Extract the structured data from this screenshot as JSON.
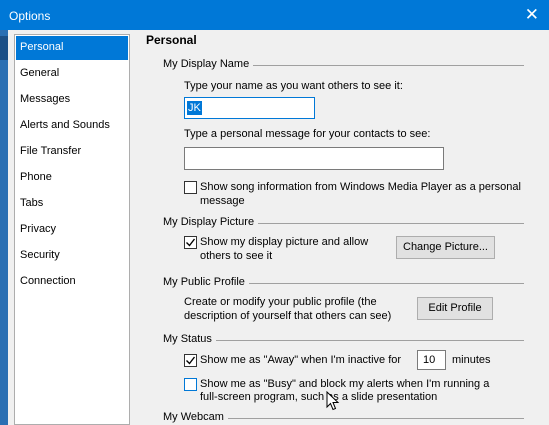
{
  "window": {
    "title": "Options",
    "close_glyph": "✕"
  },
  "sidebar": {
    "items": [
      {
        "label": "Personal",
        "selected": true
      },
      {
        "label": "General",
        "selected": false
      },
      {
        "label": "Messages",
        "selected": false
      },
      {
        "label": "Alerts and Sounds",
        "selected": false
      },
      {
        "label": "File Transfer",
        "selected": false
      },
      {
        "label": "Phone",
        "selected": false
      },
      {
        "label": "Tabs",
        "selected": false
      },
      {
        "label": "Privacy",
        "selected": false
      },
      {
        "label": "Security",
        "selected": false
      },
      {
        "label": "Connection",
        "selected": false
      }
    ]
  },
  "page": {
    "heading": "Personal",
    "display_name": {
      "group_label": "My Display Name",
      "name_prompt": "Type your name as you want others to see it:",
      "name_value": "JK",
      "message_prompt": "Type a personal message for your contacts to see:",
      "message_value": "",
      "song_checkbox_line1": "Show song information from Windows Media Player as a personal",
      "song_checkbox_line2": "message",
      "song_checked": false
    },
    "display_picture": {
      "group_label": "My Display Picture",
      "show_line1": "Show my display picture and allow",
      "show_line2": "others to see it",
      "show_checked": true,
      "change_button": "Change Picture..."
    },
    "public_profile": {
      "group_label": "My Public Profile",
      "desc_line1": "Create or modify your public profile (the",
      "desc_line2": "description of yourself that others can see)",
      "edit_button": "Edit Profile"
    },
    "status": {
      "group_label": "My Status",
      "away_label": "Show me as \"Away\" when I'm inactive for",
      "away_checked": true,
      "away_minutes": "10",
      "minutes_label": "minutes",
      "busy_line1": "Show me as \"Busy\" and block my alerts when I'm running a",
      "busy_line2": "full-screen program, such as a slide presentation",
      "busy_checked": false
    },
    "webcam": {
      "group_label": "My Webcam"
    }
  },
  "colors": {
    "accent": "#0078d7",
    "titlebar": "#0078d7"
  }
}
